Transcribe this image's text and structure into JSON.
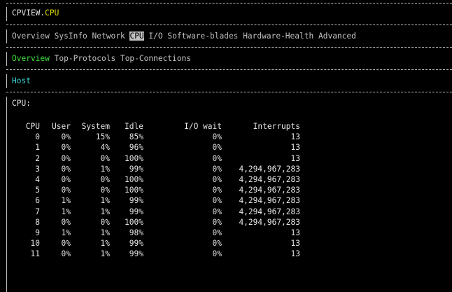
{
  "title": {
    "app": "CPVIEW",
    "dot": ".",
    "section": "CPU"
  },
  "menu": {
    "items": [
      {
        "label": "Overview",
        "active": false
      },
      {
        "label": "SysInfo",
        "active": false
      },
      {
        "label": "Network",
        "active": false
      },
      {
        "label": "CPU",
        "active": true
      },
      {
        "label": "I/O",
        "active": false
      },
      {
        "label": "Software-blades",
        "active": false
      },
      {
        "label": "Hardware-Health",
        "active": false
      },
      {
        "label": "Advanced",
        "active": false
      }
    ]
  },
  "submenu": {
    "items": [
      {
        "label": "Overview",
        "active": true
      },
      {
        "label": "Top-Protocols",
        "active": false
      },
      {
        "label": "Top-Connections",
        "active": false
      }
    ]
  },
  "section_label": "Host",
  "cpu_heading": "CPU:",
  "table": {
    "headers": [
      "CPU",
      "User",
      "System",
      "Idle",
      "I/O wait",
      "Interrupts"
    ],
    "rows": [
      [
        "0",
        "0%",
        "15%",
        "85%",
        "0%",
        "13"
      ],
      [
        "1",
        "0%",
        "4%",
        "96%",
        "0%",
        "13"
      ],
      [
        "2",
        "0%",
        "0%",
        "100%",
        "0%",
        "13"
      ],
      [
        "3",
        "0%",
        "1%",
        "99%",
        "0%",
        "4,294,967,283"
      ],
      [
        "4",
        "0%",
        "0%",
        "100%",
        "0%",
        "4,294,967,283"
      ],
      [
        "5",
        "0%",
        "0%",
        "100%",
        "0%",
        "4,294,967,283"
      ],
      [
        "6",
        "1%",
        "1%",
        "99%",
        "0%",
        "4,294,967,283"
      ],
      [
        "7",
        "1%",
        "1%",
        "99%",
        "0%",
        "4,294,967,283"
      ],
      [
        "8",
        "0%",
        "0%",
        "100%",
        "0%",
        "4,294,967,283"
      ],
      [
        "9",
        "1%",
        "1%",
        "98%",
        "0%",
        "13"
      ],
      [
        "10",
        "0%",
        "1%",
        "99%",
        "0%",
        "13"
      ],
      [
        "11",
        "0%",
        "1%",
        "99%",
        "0%",
        "13"
      ]
    ]
  },
  "colors": {
    "background": "#000000",
    "text": "#c0c0c0",
    "title_accent": "#e0e000",
    "active_submenu": "#40e040",
    "section_label": "#40d8d8",
    "highlight_bg": "#c0c0c0"
  }
}
